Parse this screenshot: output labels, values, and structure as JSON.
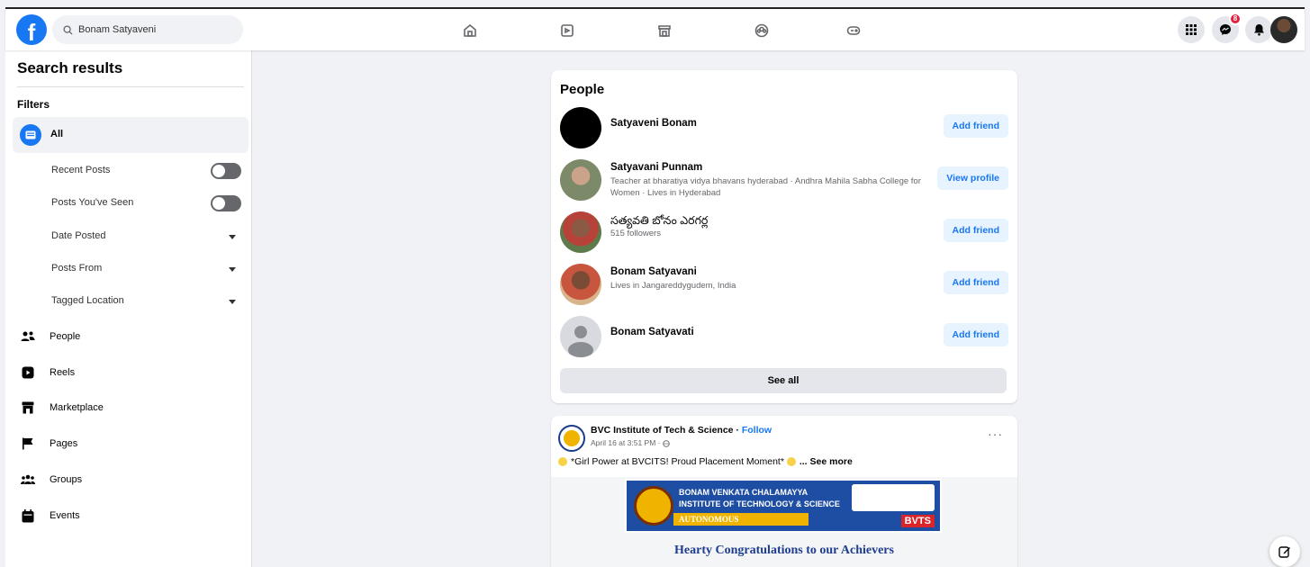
{
  "header": {
    "logo_letter": "f",
    "search_value": "Bonam Satyaveni",
    "nav_icons": [
      "home-icon",
      "video-icon",
      "marketplace-icon",
      "groups-icon",
      "gaming-icon"
    ],
    "right_icons": [
      "menu-grid-icon",
      "messenger-icon",
      "notifications-icon",
      "profile-avatar"
    ],
    "messenger_badge": "8"
  },
  "sidebar": {
    "title": "Search results",
    "filters_label": "Filters",
    "all_label": "All",
    "sub_filters": [
      {
        "label": "Recent Posts",
        "control": "toggle"
      },
      {
        "label": "Posts You've Seen",
        "control": "toggle"
      },
      {
        "label": "Date Posted",
        "control": "dropdown"
      },
      {
        "label": "Posts From",
        "control": "dropdown"
      },
      {
        "label": "Tagged Location",
        "control": "dropdown"
      }
    ],
    "categories": [
      {
        "label": "People",
        "icon": "people-icon"
      },
      {
        "label": "Reels",
        "icon": "reels-icon"
      },
      {
        "label": "Marketplace",
        "icon": "marketplace-icon"
      },
      {
        "label": "Pages",
        "icon": "pages-flag-icon"
      },
      {
        "label": "Groups",
        "icon": "groups-icon"
      },
      {
        "label": "Events",
        "icon": "events-icon"
      }
    ]
  },
  "people": {
    "title": "People",
    "results": [
      {
        "name": "Satyaveni Bonam",
        "subtitle": "",
        "action": "Add friend"
      },
      {
        "name": "Satyavani Punnam",
        "subtitle": "Teacher at bharatiya vidya bhavans hyderabad · Andhra Mahila Sabha College for Women · Lives in Hyderabad",
        "action": "View profile"
      },
      {
        "name": "సత్యవతి బోనం ఎరగర్ల",
        "subtitle": "515 followers",
        "action": "Add friend"
      },
      {
        "name": "Bonam Satyavani",
        "subtitle": "Lives in Jangareddygudem, India",
        "action": "Add friend"
      },
      {
        "name": "Bonam Satyavati",
        "subtitle": "",
        "action": "Add friend"
      }
    ],
    "see_all": "See all"
  },
  "post": {
    "author": "BVC Institute of Tech & Science",
    "follow_sep": " · ",
    "follow_label": "Follow",
    "date": "April 16 at 3:51 PM · ",
    "text": "*Girl Power at BVCITS! Proud Placement Moment* ",
    "see_more": "... See more",
    "banner_line1": "BONAM VENKATA CHALAMAYYA",
    "banner_line2": "INSTITUTE OF TECHNOLOGY & SCIENCE",
    "banner_line3": "AUTONOMOUS",
    "banner_code": "BVTS",
    "image_caption": "Hearty Congratulations to our Achievers"
  }
}
